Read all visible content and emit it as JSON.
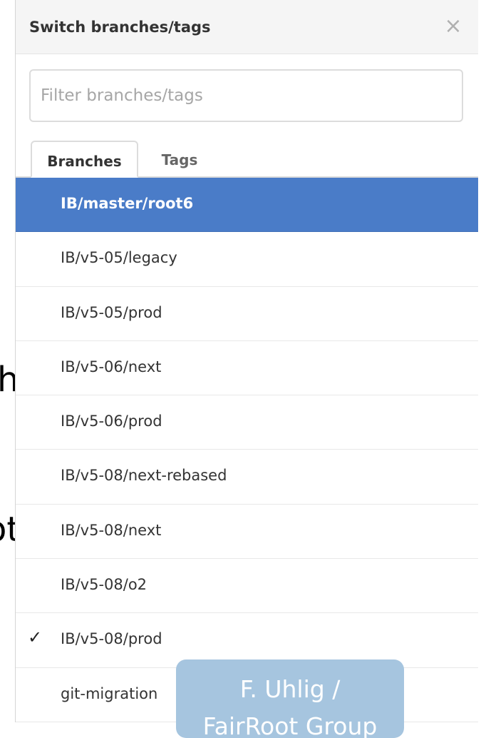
{
  "slide": {
    "fragment_1": "h",
    "fragment_2": "ot"
  },
  "popup": {
    "title": "Switch branches/tags",
    "close_symbol": "×",
    "filter_placeholder": "Filter branches/tags",
    "tabs": [
      {
        "label": "Branches",
        "active": true
      },
      {
        "label": "Tags",
        "active": false
      }
    ],
    "branches": [
      {
        "label": "IB/master/root6",
        "selected": true,
        "checked": false
      },
      {
        "label": "IB/v5-05/legacy",
        "selected": false,
        "checked": false
      },
      {
        "label": "IB/v5-05/prod",
        "selected": false,
        "checked": false
      },
      {
        "label": "IB/v5-06/next",
        "selected": false,
        "checked": false
      },
      {
        "label": "IB/v5-06/prod",
        "selected": false,
        "checked": false
      },
      {
        "label": "IB/v5-08/next-rebased",
        "selected": false,
        "checked": false
      },
      {
        "label": "IB/v5-08/next",
        "selected": false,
        "checked": false
      },
      {
        "label": "IB/v5-08/o2",
        "selected": false,
        "checked": false
      },
      {
        "label": "IB/v5-08/prod",
        "selected": false,
        "checked": true
      },
      {
        "label": "git-migration",
        "selected": false,
        "checked": false
      }
    ],
    "check_symbol": "✓"
  },
  "footer": {
    "author_line_1": "F. Uhlig /",
    "author_line_2": "FairRoot Group"
  },
  "colors": {
    "selected_bg": "#4a7cc8",
    "badge_bg": "#a6c5df"
  }
}
